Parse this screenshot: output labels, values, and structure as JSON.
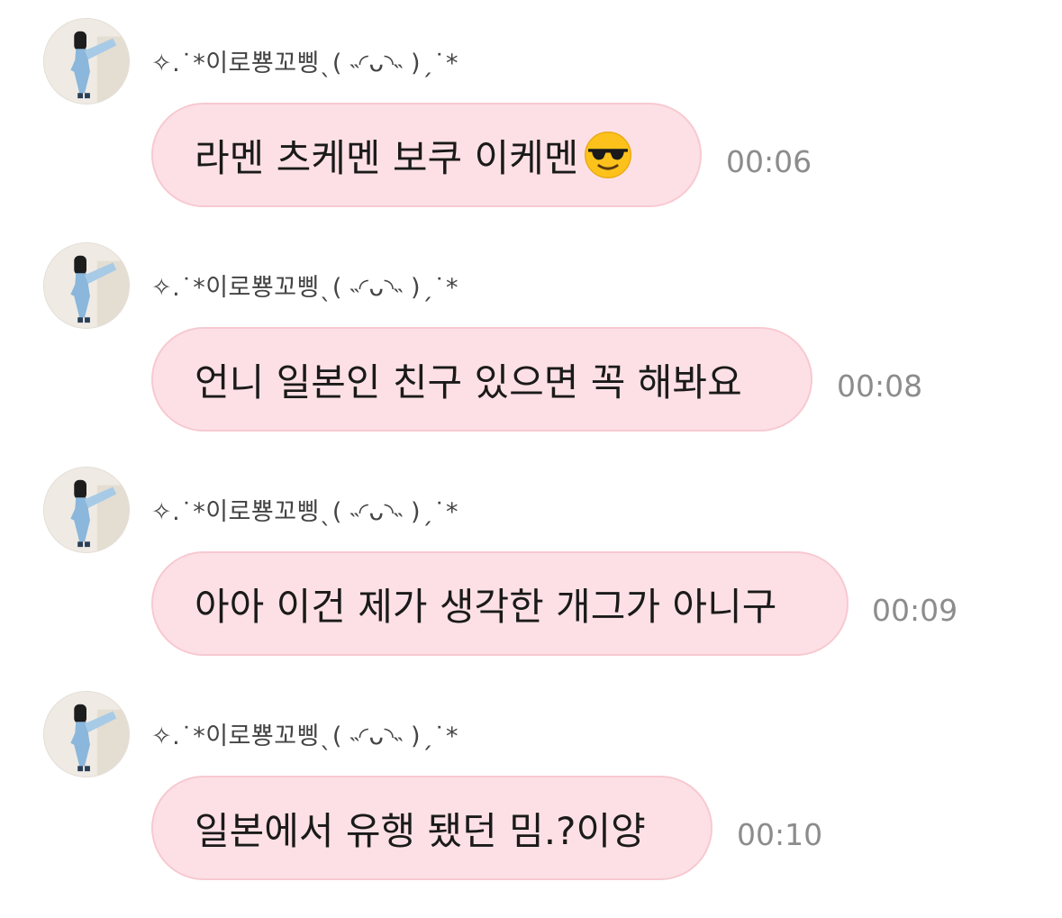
{
  "messages": [
    {
      "sender": "✧.˙*이로뿅꼬삥ˎ( ˵◜ᴗ◝˵ )ˏ˙*",
      "text": "라멘 츠케멘 보쿠 이케멘",
      "emoji": "smiling-face-with-sunglasses",
      "time": "00:06"
    },
    {
      "sender": "✧.˙*이로뿅꼬삥ˎ( ˵◜ᴗ◝˵ )ˏ˙*",
      "text": "언니 일본인 친구 있으면 꼭 해봐요",
      "time": "00:08"
    },
    {
      "sender": "✧.˙*이로뿅꼬삥ˎ( ˵◜ᴗ◝˵ )ˏ˙*",
      "text": "아아 이건 제가 생각한 개그가 아니구",
      "time": "00:09"
    },
    {
      "sender": "✧.˙*이로뿅꼬삥ˎ( ˵◜ᴗ◝˵ )ˏ˙*",
      "text": "일본에서 유행 됐던 밈.?이양",
      "time": "00:10"
    }
  ],
  "colors": {
    "bubble_bg": "#fde0e5",
    "bubble_border": "#f7c9d1",
    "time_text": "#8c8c8c"
  }
}
